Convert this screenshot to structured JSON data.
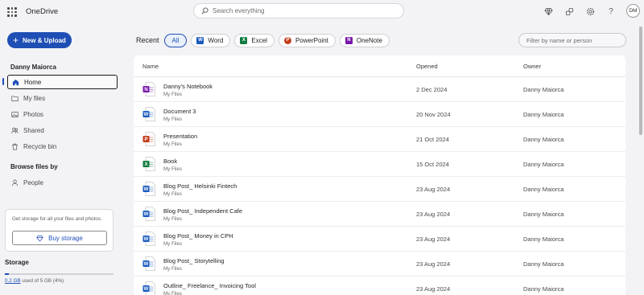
{
  "header": {
    "app_title": "OneDrive",
    "search_placeholder": "Search everything",
    "icons": [
      "diamond-icon",
      "link-icon",
      "gear-icon",
      "help-icon"
    ],
    "help_label": "?",
    "avatar_initials": "DM"
  },
  "sidebar": {
    "new_upload_plus": "+",
    "new_upload_label": "New & Upload",
    "user_name": "Danny Maiorca",
    "nav": [
      {
        "label": "Home",
        "icon": "home-icon",
        "active": true
      },
      {
        "label": "My files",
        "icon": "folder-icon"
      },
      {
        "label": "Photos",
        "icon": "photo-icon"
      },
      {
        "label": "Shared",
        "icon": "people-icon"
      },
      {
        "label": "Recycle bin",
        "icon": "trash-icon"
      }
    ],
    "browse_heading": "Browse files by",
    "browse": [
      {
        "label": "People",
        "icon": "person-icon"
      }
    ],
    "storage_card_msg": "Get storage for all your files and photos.",
    "buy_storage_label": "Buy storage",
    "storage_heading": "Storage",
    "storage_used": "0.2 GB",
    "storage_rest": " used of 5 GB (4%)",
    "storage_fraction": 0.04
  },
  "filters": {
    "recent_label": "Recent",
    "pills": [
      {
        "label": "All",
        "selected": true
      },
      {
        "label": "Word",
        "icon": "word-icon",
        "color": "#185abd",
        "glyph": "W"
      },
      {
        "label": "Excel",
        "icon": "excel-icon",
        "color": "#107c41",
        "glyph": "X"
      },
      {
        "label": "PowerPoint",
        "icon": "powerpoint-icon",
        "color": "#c43e1c",
        "glyph": "P"
      },
      {
        "label": "OneNote",
        "icon": "onenote-icon",
        "color": "#7719aa",
        "glyph": "N"
      }
    ],
    "filter_placeholder": "Filter by name or person"
  },
  "table": {
    "columns": {
      "name": "Name",
      "opened": "Opened",
      "owner": "Owner"
    },
    "rows": [
      {
        "name": "Danny's Notebook",
        "location": "My Files",
        "opened": "2 Dec 2024",
        "owner": "Danny Maiorca",
        "type": "onenote"
      },
      {
        "name": "Document 3",
        "location": "My Files",
        "opened": "20 Nov 2024",
        "owner": "Danny Maiorca",
        "type": "word"
      },
      {
        "name": "Presentation",
        "location": "My Files",
        "opened": "21 Oct 2024",
        "owner": "Danny Maiorca",
        "type": "powerpoint"
      },
      {
        "name": "Book",
        "location": "My Files",
        "opened": "15 Oct 2024",
        "owner": "Danny Maiorca",
        "type": "excel"
      },
      {
        "name": "Blog Post_ Helsinki Fintech",
        "location": "My Files",
        "opened": "23 Aug 2024",
        "owner": "Danny Maiorca",
        "type": "word"
      },
      {
        "name": "Blog Post_ Independent Cafe",
        "location": "My Files",
        "opened": "23 Aug 2024",
        "owner": "Danny Maiorca",
        "type": "word"
      },
      {
        "name": "Blog Post_ Money in CPH",
        "location": "My Files",
        "opened": "23 Aug 2024",
        "owner": "Danny Maiorca",
        "type": "word"
      },
      {
        "name": "Blog Post_ Storytelling",
        "location": "My Files",
        "opened": "23 Aug 2024",
        "owner": "Danny Maiorca",
        "type": "word"
      },
      {
        "name": "Outline_ Freelance_ Invoicing Tool",
        "location": "My Files",
        "opened": "23 Aug 2024",
        "owner": "Danny Maiorca",
        "type": "word"
      }
    ]
  },
  "colors": {
    "accent": "#1f4fb5",
    "word": "#185abd",
    "excel": "#107c41",
    "powerpoint": "#c43e1c",
    "onenote": "#7719aa"
  }
}
